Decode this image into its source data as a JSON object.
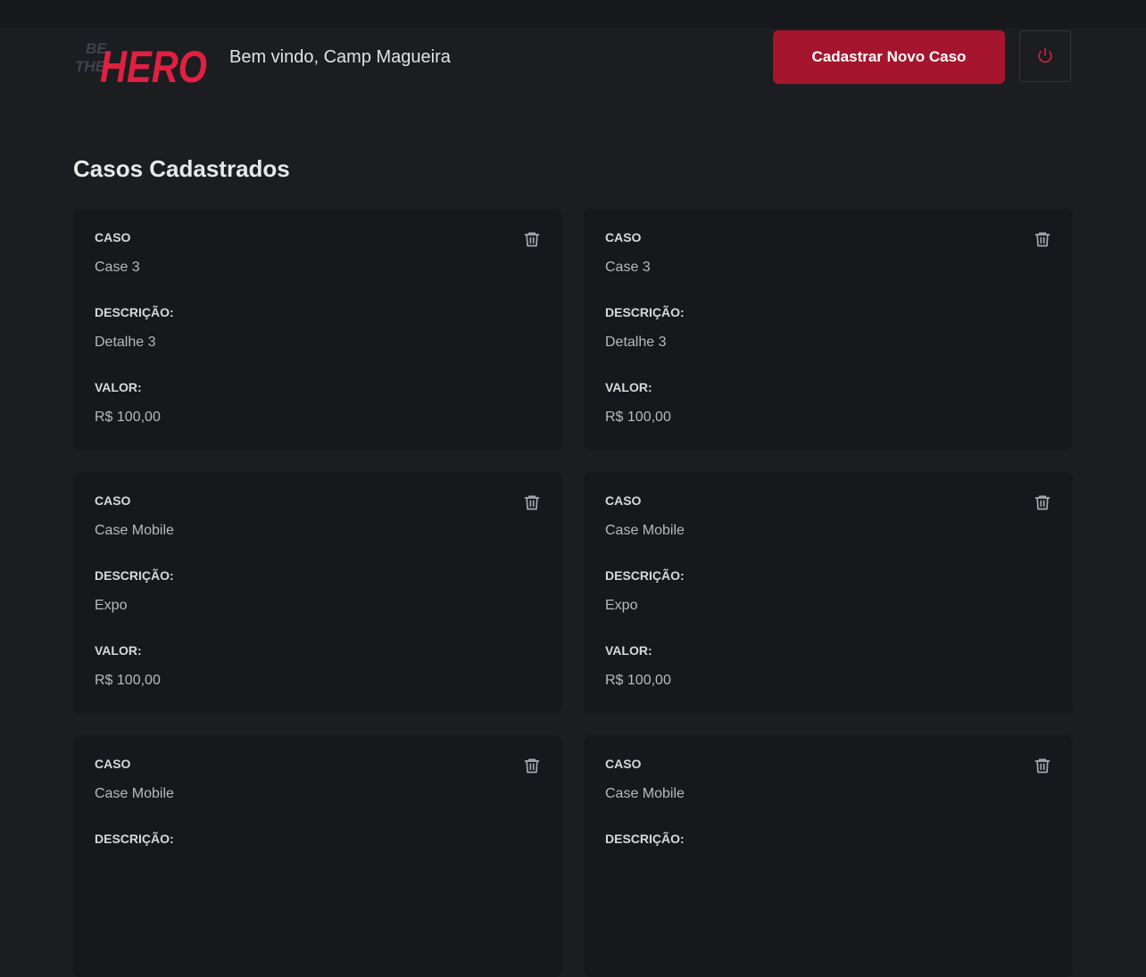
{
  "app": {
    "logo_text_small": [
      "BE",
      "THE"
    ],
    "logo_text_big": "HERO",
    "greeting": "Bem vindo, Camp Magueira",
    "new_case_label": "Cadastrar Novo Caso",
    "logout_icon": "power-icon",
    "colors": {
      "accent": "#a5152d",
      "logo_red": "#e02041",
      "background": "#1c1d20",
      "card": "#17181b"
    }
  },
  "page": {
    "title": "Casos Cadastrados"
  },
  "labels": {
    "case": "CASO",
    "description": "DESCRIÇÃO:",
    "value": "VALOR:"
  },
  "cases": [
    {
      "title": "Case 3",
      "description": "Detalhe 3",
      "value": "R$ 100,00"
    },
    {
      "title": "Case 3",
      "description": "Detalhe 3",
      "value": "R$ 100,00"
    },
    {
      "title": "Case Mobile",
      "description": "Expo",
      "value": "R$ 100,00"
    },
    {
      "title": "Case Mobile",
      "description": "Expo",
      "value": "R$ 100,00"
    },
    {
      "title": "Case Mobile",
      "description": "",
      "value": ""
    },
    {
      "title": "Case Mobile",
      "description": "",
      "value": ""
    }
  ]
}
